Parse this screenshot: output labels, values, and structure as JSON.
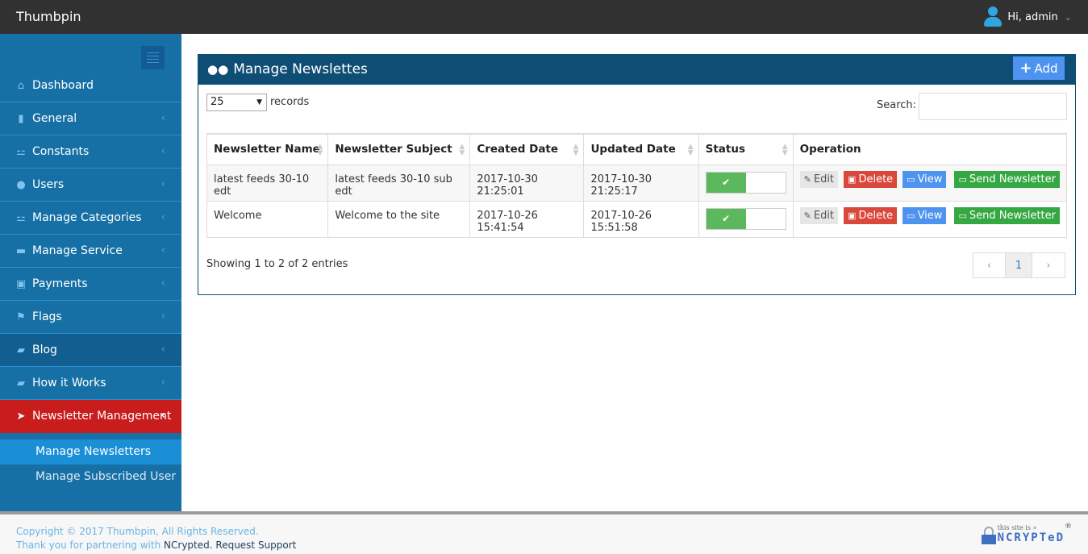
{
  "app": {
    "brand": "Thumbpin",
    "user_greeting": "Hi, admin"
  },
  "sidebar": {
    "items": [
      {
        "label": "Dashboard",
        "icon": "home-icon",
        "glyph": "⌂",
        "has_arrow": false
      },
      {
        "label": "General",
        "icon": "file-icon",
        "glyph": "▮",
        "has_arrow": true
      },
      {
        "label": "Constants",
        "icon": "sitemap-icon",
        "glyph": "⚍",
        "has_arrow": true
      },
      {
        "label": "Users",
        "icon": "users-icon",
        "glyph": "●",
        "has_arrow": true
      },
      {
        "label": "Manage Categories",
        "icon": "sitemap-icon",
        "glyph": "⚍",
        "has_arrow": true
      },
      {
        "label": "Manage Service",
        "icon": "briefcase-icon",
        "glyph": "▬",
        "has_arrow": true
      },
      {
        "label": "Payments",
        "icon": "money-icon",
        "glyph": "▣",
        "has_arrow": true
      },
      {
        "label": "Flags",
        "icon": "flag-icon",
        "glyph": "⚑",
        "has_arrow": true
      },
      {
        "label": "Blog",
        "icon": "book-icon",
        "glyph": "▰",
        "has_arrow": true
      },
      {
        "label": "How it Works",
        "icon": "book-icon",
        "glyph": "▰",
        "has_arrow": true
      },
      {
        "label": "Newsletter Management",
        "icon": "location-arrow-icon",
        "glyph": "➤",
        "has_arrow": true
      }
    ],
    "sub_items": [
      {
        "label": "Manage Newsletters"
      },
      {
        "label": "Manage Subscribed User"
      }
    ],
    "arrow_glyph": "‹"
  },
  "panel": {
    "title": "Manage Newslettes",
    "add_label": "Add",
    "length_value": "25",
    "length_suffix": "records",
    "search_label": "Search:",
    "search_value": "",
    "columns": [
      "Newsletter Name",
      "Newsletter Subject",
      "Created Date",
      "Updated Date",
      "Status",
      "Operation"
    ],
    "rows": [
      {
        "name": "latest feeds 30-10 edt",
        "subject": "latest feeds 30-10 sub edt",
        "created": "2017-10-30 21:25:01",
        "updated": "2017-10-30 21:25:17",
        "status_on": true
      },
      {
        "name": "Welcome",
        "subject": "Welcome to the site",
        "created": "2017-10-26 15:41:54",
        "updated": "2017-10-26 15:51:58",
        "status_on": true
      }
    ],
    "ops": {
      "edit": "Edit",
      "delete": "Delete",
      "view": "View",
      "send": "Send Newsletter"
    },
    "info": "Showing 1 to 2 of 2 entries",
    "pager": {
      "prev": "‹",
      "current": "1",
      "next": "›"
    }
  },
  "footer": {
    "copyright": "Copyright © 2017 Thumbpin, All Rights Reserved.",
    "thanks": "Thank you for partnering with",
    "partner": "NCrypted.",
    "support": "Request Support",
    "badge_small": "this site is »",
    "badge_big": "NCRYPTeD",
    "badge_reg": "®"
  },
  "colors": {
    "topbar": "#313131",
    "sidebar": "#1670a5",
    "active": "#c91c1d",
    "panel_head": "#0f4e74",
    "primary": "#4e93f0",
    "success": "#36a843",
    "danger": "#d9483b"
  }
}
